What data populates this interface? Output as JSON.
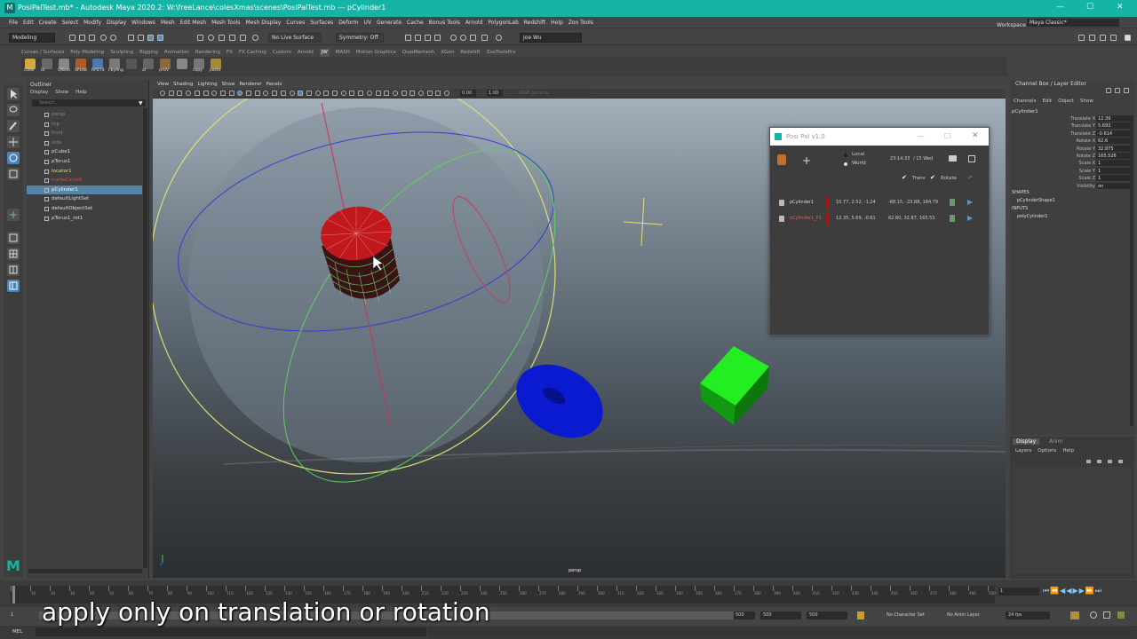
{
  "window": {
    "title": "PosiPalTest.mb* - Autodesk Maya 2020.2: W:\\freeLance\\colesXmas\\scenes\\PosiPalTest.mb   ---   pCylinder1",
    "controls": [
      "—",
      "☐",
      "✕"
    ]
  },
  "menubar": {
    "items": [
      "File",
      "Edit",
      "Create",
      "Select",
      "Modify",
      "Display",
      "Windows",
      "Mesh",
      "Edit Mesh",
      "Mesh Tools",
      "Mesh Display",
      "Curves",
      "Surfaces",
      "Deform",
      "UV",
      "Generate",
      "Cache",
      "Bonus Tools",
      "Arnold",
      "PolygonLab",
      "Redshift",
      "Help",
      "Zoo Tools"
    ],
    "workspace_label": "Workspace :",
    "workspace_value": "Maya Classic*"
  },
  "statusline": {
    "mode": "Modeling",
    "live_surface": "No Live Surface",
    "symmetry": "Symmetry: Off",
    "user": "Joe Wu"
  },
  "shelf": {
    "tabs": [
      "Curves / Surfaces",
      "Poly Modeling",
      "Sculpting",
      "Rigging",
      "Animation",
      "Rendering",
      "FX",
      "FX Caching",
      "Custom",
      "Arnold",
      "JW",
      "MASH",
      "Motion Graphics",
      "QuadRemesh",
      "XGen",
      "Redshift",
      "ZooToolsPro"
    ],
    "active_tab": "JW",
    "buttons": [
      "Code",
      "UI",
      "QNote",
      "SPL68",
      "RPZ74",
      "FbyAng",
      "",
      "al",
      "prUV",
      "",
      "copy",
      "paste"
    ]
  },
  "outliner": {
    "title": "Outliner",
    "menu": [
      "Display",
      "Show",
      "Help"
    ],
    "search_placeholder": "Search...",
    "items": [
      {
        "label": "persp",
        "color": "#888"
      },
      {
        "label": "top",
        "color": "#888"
      },
      {
        "label": "front",
        "color": "#888"
      },
      {
        "label": "side",
        "color": "#888"
      },
      {
        "label": "pCube1",
        "color": "#dddddd"
      },
      {
        "label": "pTorus1",
        "color": "#dddddd"
      },
      {
        "label": "locator1",
        "color": "#f0e060"
      },
      {
        "label": "nurbsCircle1",
        "color": "#e04848"
      },
      {
        "label": "pCylinder1",
        "color": "#ffffff"
      },
      {
        "label": "defaultLightSet",
        "color": "#dddddd"
      },
      {
        "label": "defaultObjectSet",
        "color": "#dddddd"
      },
      {
        "label": "pTorus1_rot1",
        "color": "#dddddd"
      }
    ],
    "selected_index": 8
  },
  "viewport": {
    "menu": [
      "View",
      "Shading",
      "Lighting",
      "Show",
      "Renderer",
      "Panels"
    ],
    "field_a": "0.00",
    "field_b": "1.00",
    "color_space": "sRGB gamma",
    "camera_label": "persp"
  },
  "posipal": {
    "title": "Posi Pal v1.0",
    "space_options": [
      "Local",
      "World"
    ],
    "time": "23:14:33",
    "date": "/ 15 Wed",
    "trans_label": "Trans",
    "rotate_label": "Rotate",
    "trans_checked": true,
    "rotate_checked": true,
    "entries": [
      {
        "name": "pCylinder1",
        "trans": "10.77, 2.52, -1.24",
        "rot": "-68.15, -23.88, 184.79",
        "name_color": "#dddddd"
      },
      {
        "name": "pCylinder1_P1",
        "trans": "12.35, 5.69, -0.61",
        "rot": "62.60, 32.87, 165.53",
        "name_color": "#e06060"
      }
    ]
  },
  "channelbox": {
    "title": "Channel Box / Layer Editor",
    "menu": [
      "Channels",
      "Edit",
      "Object",
      "Show"
    ],
    "object": "pCylinder1",
    "channels": [
      {
        "name": "Translate X",
        "value": "12.39"
      },
      {
        "name": "Translate Y",
        "value": "5.693"
      },
      {
        "name": "Translate Z",
        "value": "-0.614"
      },
      {
        "name": "Rotate X",
        "value": "62.6"
      },
      {
        "name": "Rotate Y",
        "value": "32.875"
      },
      {
        "name": "Rotate Z",
        "value": "165.526"
      },
      {
        "name": "Scale X",
        "value": "1"
      },
      {
        "name": "Scale Y",
        "value": "1"
      },
      {
        "name": "Scale Z",
        "value": "1"
      },
      {
        "name": "Visibility",
        "value": "on"
      }
    ],
    "shapes_label": "SHAPES",
    "shape_name": "pCylinderShape1",
    "inputs_label": "INPUTS",
    "input_name": "polyCylinder1"
  },
  "layer_editor": {
    "tabs": [
      "Display",
      "Anim"
    ],
    "menu": [
      "Layers",
      "Options",
      "Help"
    ]
  },
  "timeline": {
    "tick_labels": [
      "1",
      "10",
      "20",
      "30",
      "40",
      "50",
      "60",
      "70",
      "80",
      "90",
      "100",
      "110",
      "120",
      "130",
      "140",
      "150",
      "160",
      "170",
      "180",
      "190",
      "200",
      "210",
      "220",
      "230",
      "240",
      "250",
      "260",
      "270",
      "280",
      "290",
      "300",
      "310",
      "320",
      "330",
      "340",
      "350",
      "360",
      "370",
      "380",
      "390",
      "400",
      "410",
      "420",
      "430",
      "440",
      "450",
      "460",
      "470",
      "480",
      "490",
      "500"
    ],
    "current_frame": "1",
    "range_start": "1",
    "range_end_a": "500",
    "range_end_b": "500",
    "range_end_c": "500",
    "character_set": "No Character Set",
    "anim_layer": "No Anim Layer",
    "fps": "24 fps"
  },
  "cmdline": {
    "label": "MEL"
  },
  "caption": "apply only on translation or rotation"
}
